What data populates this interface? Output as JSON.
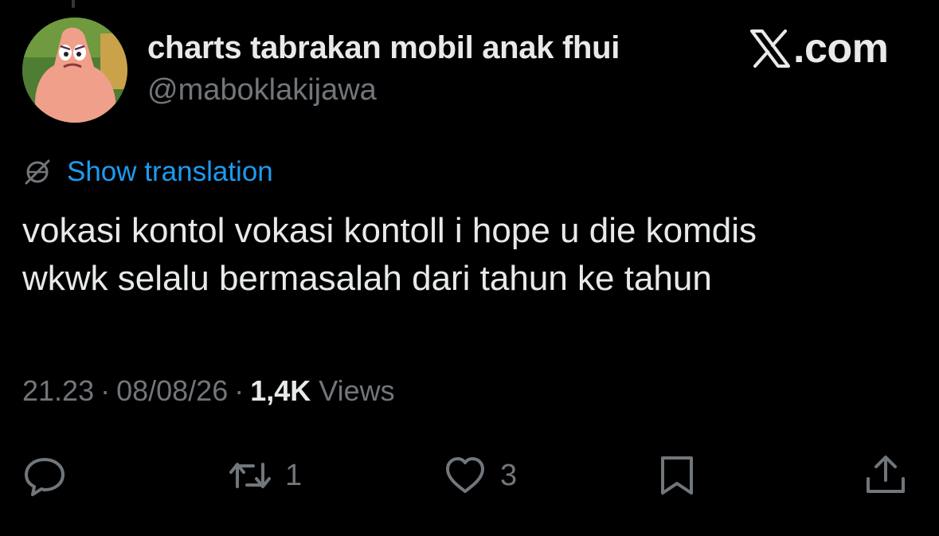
{
  "author": {
    "display_name": "charts tabrakan mobil anak fhui",
    "handle": "@maboklakijawa",
    "avatar": "patrick-star-avatar"
  },
  "brand": {
    "logo": "x-logo-icon",
    "text": ".com"
  },
  "translation": {
    "icon": "globe-slash-icon",
    "label": "Show translation"
  },
  "tweet": {
    "text": "vokasi kontol vokasi kontoll i hope u die komdis\nwkwk selalu bermasalah dari tahun ke tahun"
  },
  "meta": {
    "time": "21.23",
    "separator": "·",
    "date": "08/08/26",
    "views_count": "1,4K",
    "views_label": "Views"
  },
  "actions": {
    "reply": {
      "icon": "reply-icon",
      "count": ""
    },
    "retweet": {
      "icon": "retweet-icon",
      "count": "1"
    },
    "like": {
      "icon": "heart-icon",
      "count": "3"
    },
    "bookmark": {
      "icon": "bookmark-icon",
      "count": ""
    },
    "share": {
      "icon": "share-icon",
      "count": ""
    }
  },
  "colors": {
    "background": "#000000",
    "primary_text": "#e7e9ea",
    "secondary_text": "#71767b",
    "link": "#1d9bf0"
  }
}
